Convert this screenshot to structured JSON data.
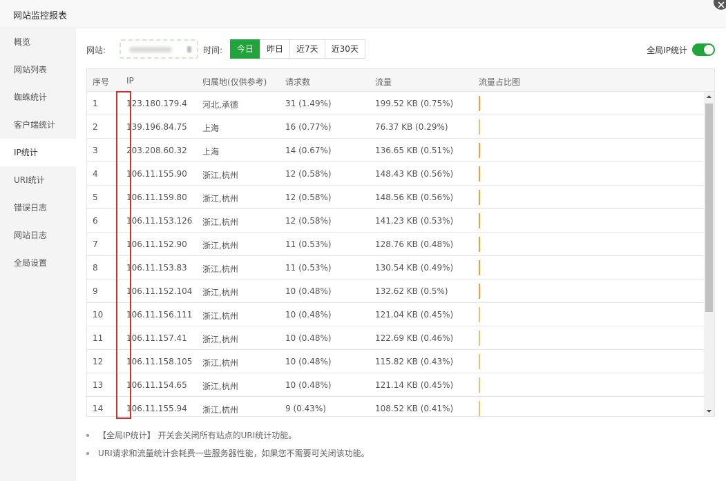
{
  "window": {
    "title": "网站监控报表"
  },
  "sidebar": {
    "items": [
      {
        "label": "概览",
        "active": false
      },
      {
        "label": "网站列表",
        "active": false
      },
      {
        "label": "蜘蛛统计",
        "active": false
      },
      {
        "label": "客户端统计",
        "active": false
      },
      {
        "label": "IP统计",
        "active": true
      },
      {
        "label": "URI统计",
        "active": false
      },
      {
        "label": "错误日志",
        "active": false
      },
      {
        "label": "网站日志",
        "active": false
      },
      {
        "label": "全局设置",
        "active": false
      }
    ]
  },
  "filter": {
    "site_label": "网站:",
    "time_label": "时间:",
    "time_tabs": [
      {
        "label": "今日",
        "active": true
      },
      {
        "label": "昨日",
        "active": false
      },
      {
        "label": "近7天",
        "active": false
      },
      {
        "label": "近30天",
        "active": false
      }
    ],
    "toggle_label": "全局IP统计",
    "toggle_on": true
  },
  "table": {
    "headers": [
      "序号",
      "IP",
      "归属地(仅供参考)",
      "请求数",
      "流量",
      "流量占比图"
    ],
    "rows": [
      {
        "index": "1",
        "ip": "123.180.179.4",
        "location": "河北,承德",
        "requests": "31 (1.49%)",
        "traffic": "199.52 KB (0.75%)"
      },
      {
        "index": "2",
        "ip": "139.196.84.75",
        "location": "上海",
        "requests": "16 (0.77%)",
        "traffic": "76.37 KB (0.29%)"
      },
      {
        "index": "3",
        "ip": "203.208.60.32",
        "location": "上海",
        "requests": "14 (0.67%)",
        "traffic": "136.65 KB (0.51%)"
      },
      {
        "index": "4",
        "ip": "106.11.155.90",
        "location": "浙江,杭州",
        "requests": "12 (0.58%)",
        "traffic": "148.43 KB (0.56%)"
      },
      {
        "index": "5",
        "ip": "106.11.159.80",
        "location": "浙江,杭州",
        "requests": "12 (0.58%)",
        "traffic": "148.56 KB (0.56%)"
      },
      {
        "index": "6",
        "ip": "106.11.153.126",
        "location": "浙江,杭州",
        "requests": "12 (0.58%)",
        "traffic": "141.23 KB (0.53%)"
      },
      {
        "index": "7",
        "ip": "106.11.152.90",
        "location": "浙江,杭州",
        "requests": "11 (0.53%)",
        "traffic": "128.76 KB (0.48%)"
      },
      {
        "index": "8",
        "ip": "106.11.153.83",
        "location": "浙江,杭州",
        "requests": "11 (0.53%)",
        "traffic": "130.54 KB (0.49%)"
      },
      {
        "index": "9",
        "ip": "106.11.152.104",
        "location": "浙江,杭州",
        "requests": "10 (0.48%)",
        "traffic": "132.62 KB (0.5%)"
      },
      {
        "index": "10",
        "ip": "106.11.156.111",
        "location": "浙江,杭州",
        "requests": "10 (0.48%)",
        "traffic": "121.04 KB (0.45%)"
      },
      {
        "index": "11",
        "ip": "106.11.157.41",
        "location": "浙江,杭州",
        "requests": "10 (0.48%)",
        "traffic": "122.69 KB (0.46%)"
      },
      {
        "index": "12",
        "ip": "106.11.158.105",
        "location": "浙江,杭州",
        "requests": "10 (0.48%)",
        "traffic": "115.82 KB (0.43%)"
      },
      {
        "index": "13",
        "ip": "106.11.154.65",
        "location": "浙江,杭州",
        "requests": "10 (0.48%)",
        "traffic": "121.14 KB (0.45%)"
      },
      {
        "index": "14",
        "ip": "106.11.155.94",
        "location": "浙江,杭州",
        "requests": "9 (0.43%)",
        "traffic": "108.52 KB (0.41%)"
      }
    ]
  },
  "notes": [
    "【全局IP统计】 开关会关闭所有站点的URI统计功能。",
    "URI请求和流量统计会耗费一些服务器性能，如果您不需要可关闭该功能。"
  ],
  "colors": {
    "accent": "#20a53a",
    "bar": "#f0a32b",
    "highlight": "#d32f2f"
  }
}
